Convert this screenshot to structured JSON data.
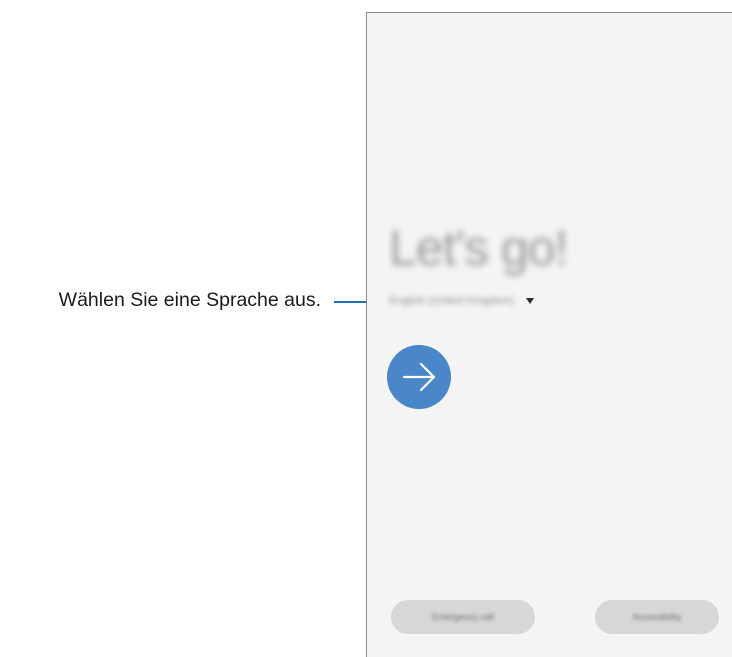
{
  "callout": {
    "text": "Wählen Sie eine Sprache aus."
  },
  "screen": {
    "title": "Let's go!",
    "language": {
      "value": "English (United Kingdom)",
      "icon": "dropdown-triangle"
    },
    "next_button": {
      "icon": "arrow-right"
    },
    "buttons": {
      "emergency_label": "Emergency call",
      "accessibility_label": "Accessibility"
    }
  },
  "colors": {
    "accent": "#4a87c9",
    "callout_line": "#1e6db5",
    "screen_background": "#f4f4f4"
  }
}
